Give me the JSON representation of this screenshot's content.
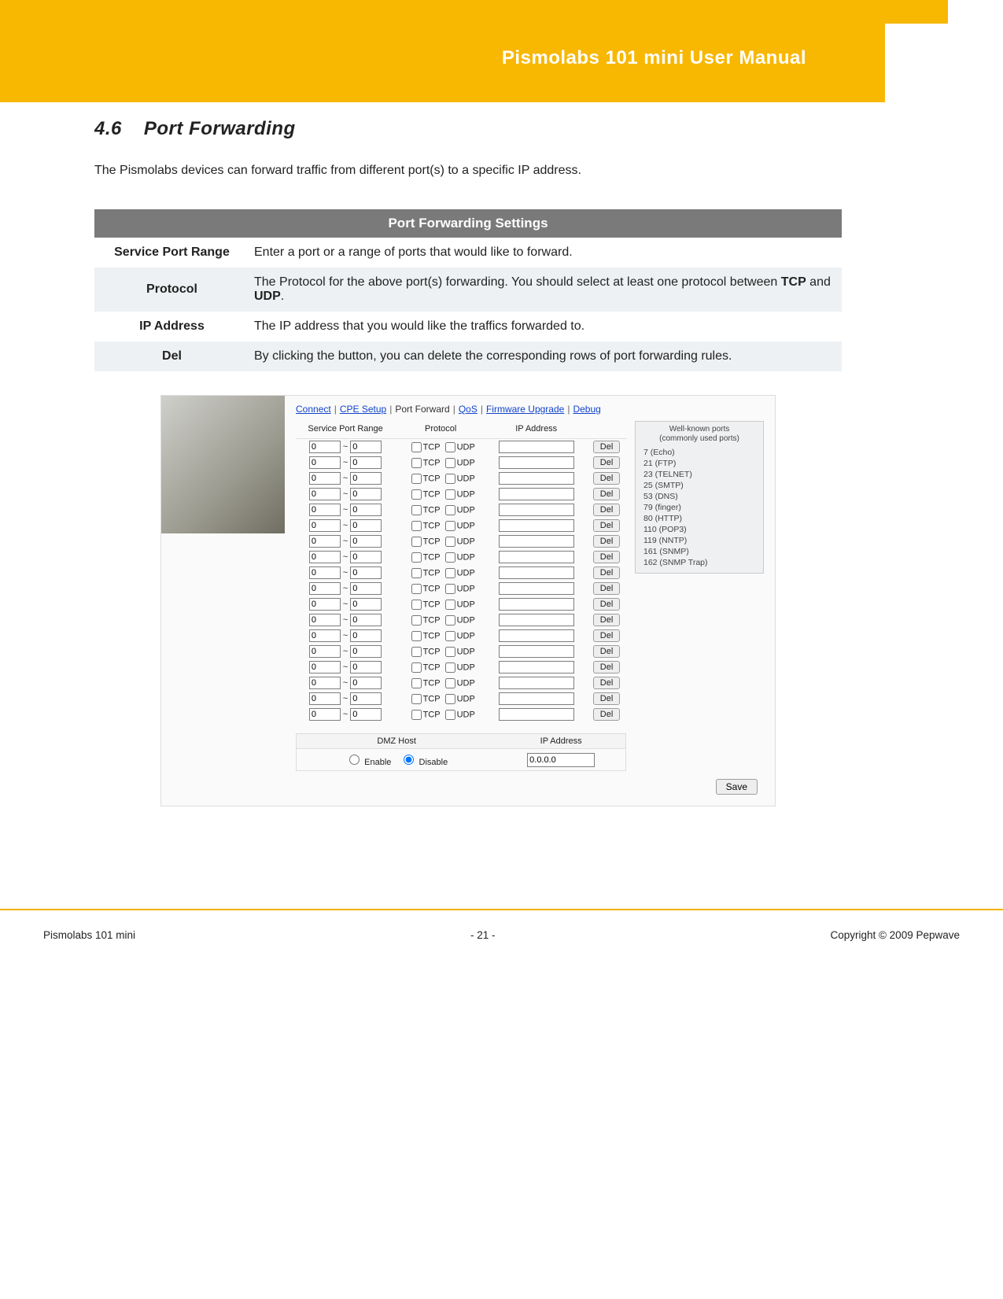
{
  "header": {
    "title": "Pismolabs 101 mini User Manual"
  },
  "section": {
    "number": "4.6",
    "title": "Port Forwarding"
  },
  "intro": "The Pismolabs devices can forward traffic from different port(s) to a specific IP address.",
  "settings_table": {
    "header": "Port Forwarding Settings",
    "rows": [
      {
        "label": "Service Port Range",
        "desc": "Enter a port or a range of ports that would like to forward."
      },
      {
        "label": "Protocol",
        "desc_pre": "The Protocol for the above port(s) forwarding. You should select at least one protocol between ",
        "desc_b1": "TCP",
        "desc_mid": " and ",
        "desc_b2": "UDP",
        "desc_post": "."
      },
      {
        "label": "IP Address",
        "desc": "The IP address that you would like the traffics forwarded to."
      },
      {
        "label": "Del",
        "desc": "By clicking the button, you can delete the corresponding rows of port forwarding rules."
      }
    ]
  },
  "ui": {
    "tabs": {
      "items": [
        "Connect",
        "CPE Setup",
        "Port Forward",
        "QoS",
        "Firmware Upgrade",
        "Debug"
      ],
      "current": "Port Forward"
    },
    "columns": {
      "service_port_range": "Service Port Range",
      "protocol": "Protocol",
      "ip_address": "IP Address"
    },
    "labels": {
      "tcp": "TCP",
      "udp": "UDP",
      "del": "Del",
      "tilde": "~"
    },
    "row_count": 18,
    "port_default": "0",
    "well_known": {
      "header1": "Well-known ports",
      "header2": "(commonly used ports)",
      "items": [
        "7  (Echo)",
        "21  (FTP)",
        "23  (TELNET)",
        "25  (SMTP)",
        "53  (DNS)",
        "79  (finger)",
        "80  (HTTP)",
        "110  (POP3)",
        "119  (NNTP)",
        "161  (SNMP)",
        "162  (SNMP Trap)"
      ]
    },
    "dmz": {
      "label_host": "DMZ Host",
      "label_ip": "IP Address",
      "enable": "Enable",
      "disable": "Disable",
      "ip_value": "0.0.0.0"
    },
    "save": "Save"
  },
  "footer": {
    "left": "Pismolabs 101 mini",
    "center": "- 21 -",
    "right": "Copyright © 2009 Pepwave"
  }
}
